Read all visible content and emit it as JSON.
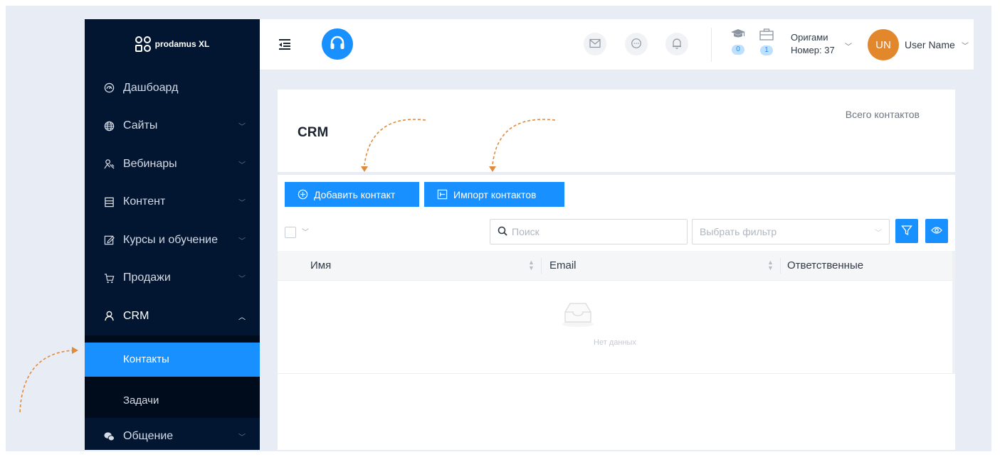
{
  "brand": {
    "name": "prodamus XL"
  },
  "sidebar": {
    "items": [
      {
        "label": "Дашбоард",
        "icon": "dashboard-icon",
        "has_children": false
      },
      {
        "label": "Сайты",
        "icon": "globe-icon",
        "has_children": true
      },
      {
        "label": "Вебинары",
        "icon": "webinar-icon",
        "has_children": true
      },
      {
        "label": "Контент",
        "icon": "content-icon",
        "has_children": true
      },
      {
        "label": "Курсы и обучение",
        "icon": "course-icon",
        "has_children": true
      },
      {
        "label": "Продажи",
        "icon": "cart-icon",
        "has_children": true
      },
      {
        "label": "CRM",
        "icon": "user-icon",
        "has_children": true,
        "expanded": true
      },
      {
        "label": "Общение",
        "icon": "chat-icon",
        "has_children": true
      }
    ],
    "crm_children": [
      {
        "label": "Контакты",
        "active": true
      },
      {
        "label": "Задачи",
        "active": false
      }
    ]
  },
  "header": {
    "badges": {
      "courses": "0",
      "orders": "1"
    },
    "project": {
      "name": "Оригами",
      "number": "Номер: 37"
    },
    "user": {
      "initials": "UN",
      "name": "User Name"
    }
  },
  "page": {
    "title": "CRM",
    "total_contacts_label": "Всего контактов",
    "add_contact_label": "Добавить контакт",
    "import_contacts_label": "Импорт контактов",
    "search_placeholder": "Поиск",
    "filter_placeholder": "Выбрать фильтр",
    "columns": [
      "Имя",
      "Email",
      "Ответственные"
    ],
    "empty_text": "Нет данных"
  },
  "colors": {
    "accent": "#1890ff",
    "sidebar_bg": "#021631",
    "avatar": "#e3872d",
    "annotation": "#e08a3c"
  }
}
